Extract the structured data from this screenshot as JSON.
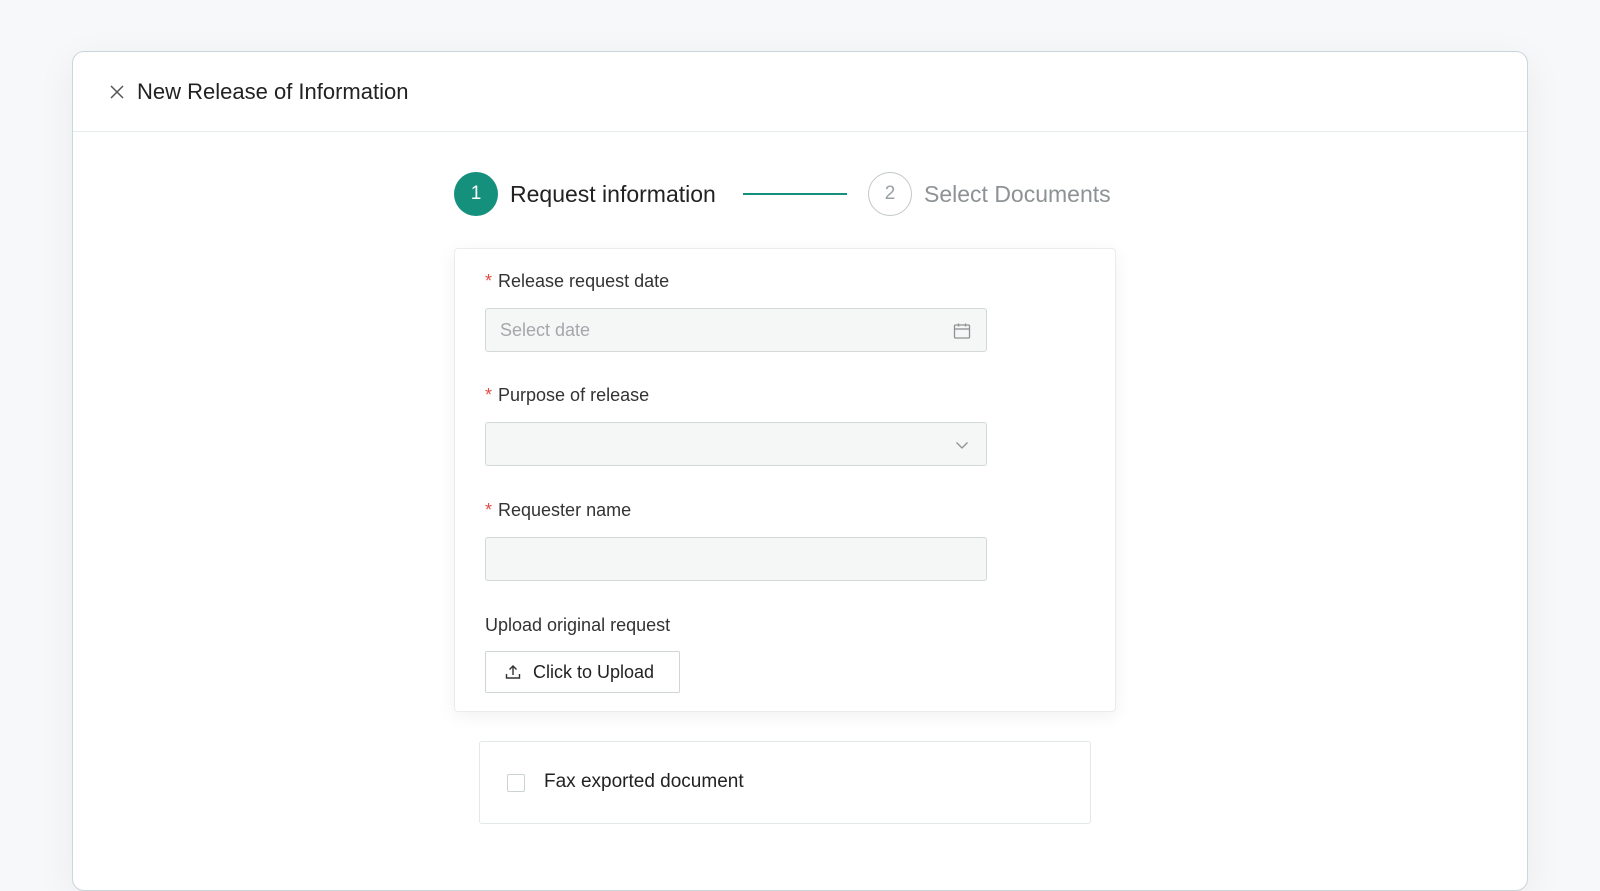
{
  "modal": {
    "title": "New Release of Information",
    "close_icon": "close-icon"
  },
  "stepper": {
    "steps": [
      {
        "number": "1",
        "label": "Request information",
        "state": "active"
      },
      {
        "number": "2",
        "label": "Select Documents",
        "state": "inactive"
      }
    ],
    "active_color": "#14907d"
  },
  "form": {
    "release_date": {
      "required_mark": "*",
      "label": "Release request date",
      "placeholder": "Select date",
      "value": "",
      "icon": "calendar-icon"
    },
    "purpose": {
      "required_mark": "*",
      "label": "Purpose of release",
      "value": "",
      "icon": "chevron-down-icon"
    },
    "requester_name": {
      "required_mark": "*",
      "label": "Requester name",
      "value": ""
    },
    "upload": {
      "label": "Upload original request",
      "button_label": "Click to Upload",
      "icon": "upload-icon"
    }
  },
  "fax": {
    "label": "Fax exported document",
    "checked": false
  }
}
